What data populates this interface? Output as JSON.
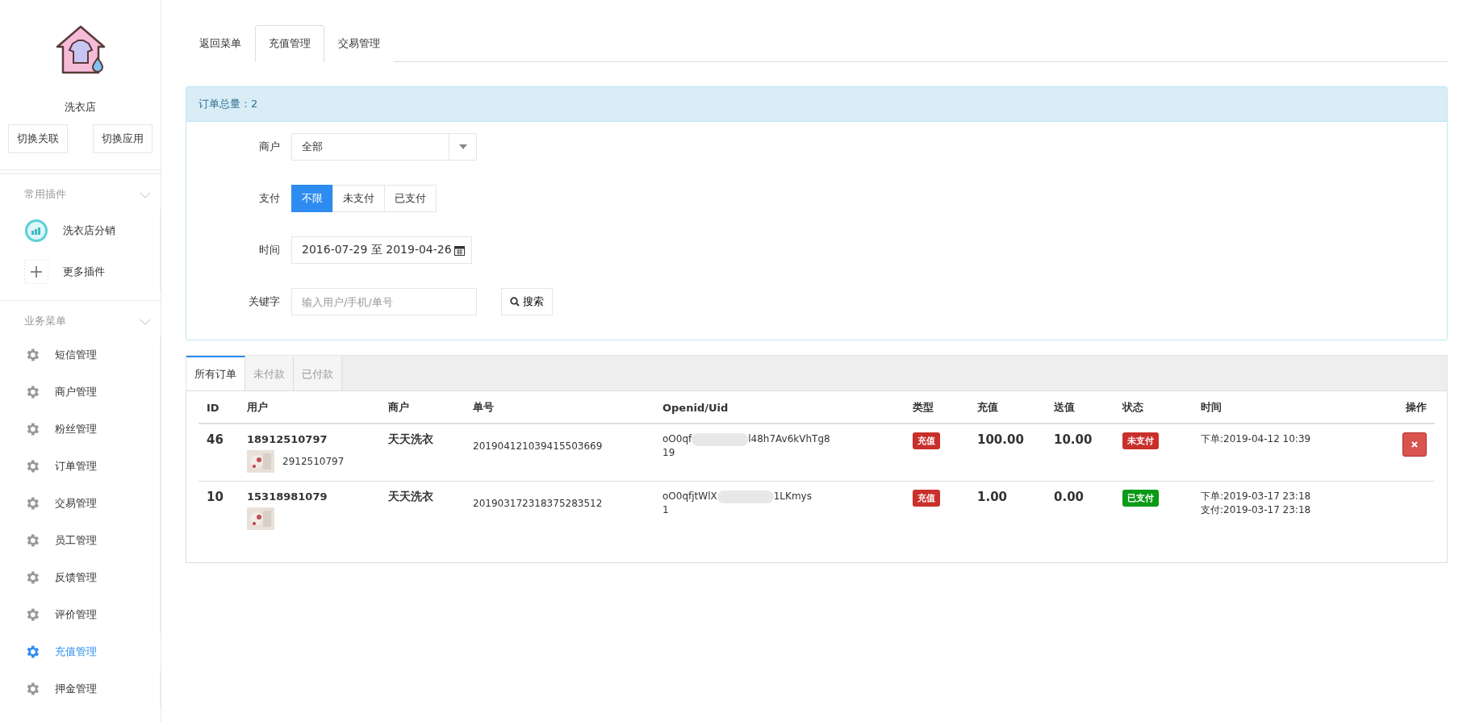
{
  "sidebar": {
    "store_name": "洗衣店",
    "buttons": [
      "切换关联",
      "切换应用"
    ],
    "sections": [
      {
        "title": "常用插件",
        "expanded": true,
        "items": [
          {
            "kind": "plugin",
            "label": "洗衣店分销",
            "selected": false
          },
          {
            "kind": "add",
            "label": "更多插件",
            "selected": false
          }
        ]
      },
      {
        "title": "业务菜单",
        "expanded": true,
        "items": [
          {
            "kind": "menu",
            "label": "短信管理",
            "selected": false
          },
          {
            "kind": "menu",
            "label": "商户管理",
            "selected": false
          },
          {
            "kind": "menu",
            "label": "粉丝管理",
            "selected": false
          },
          {
            "kind": "menu",
            "label": "订单管理",
            "selected": false
          },
          {
            "kind": "menu",
            "label": "交易管理",
            "selected": false
          },
          {
            "kind": "menu",
            "label": "员工管理",
            "selected": false
          },
          {
            "kind": "menu",
            "label": "反馈管理",
            "selected": false
          },
          {
            "kind": "menu",
            "label": "评价管理",
            "selected": false
          },
          {
            "kind": "menu",
            "label": "充值管理",
            "selected": true
          },
          {
            "kind": "menu",
            "label": "押金管理",
            "selected": false
          }
        ]
      }
    ]
  },
  "tabs": [
    {
      "label": "返回菜单",
      "selected": false
    },
    {
      "label": "充值管理",
      "selected": true
    },
    {
      "label": "交易管理",
      "selected": false
    }
  ],
  "summary": "订单总量：2",
  "filters": {
    "merchant": {
      "label": "商户",
      "value": "全部"
    },
    "payment": {
      "label": "支付",
      "options": [
        {
          "label": "不限",
          "selected": true
        },
        {
          "label": "未支付",
          "selected": false
        },
        {
          "label": "已支付",
          "selected": false
        }
      ]
    },
    "time": {
      "label": "时间",
      "value": "2016-07-29 至 2019-04-26"
    },
    "keyword": {
      "label": "关键字",
      "placeholder": "输入用户/手机/单号"
    },
    "search_button": "搜索"
  },
  "order_tabs": [
    {
      "label": "所有订单",
      "selected": true
    },
    {
      "label": "未付款",
      "selected": false
    },
    {
      "label": "已付款",
      "selected": false
    }
  ],
  "table": {
    "columns": [
      "ID",
      "用户",
      "商户",
      "单号",
      "Openid/Uid",
      "类型",
      "充值",
      "送值",
      "状态",
      "时间",
      "操作"
    ],
    "rows": [
      {
        "id": "46",
        "user_name": "18912510797",
        "user_sub": "2912510797",
        "merchant": "天天洗衣",
        "order_no": "201904121039415503669",
        "openid_start": "oO0qf",
        "openid_end": "l48h7Av6kVhTg8",
        "openid_tail": "19",
        "type": "充值",
        "amount": "100.00",
        "bonus": "10.00",
        "status": {
          "label": "未支付",
          "paid": false
        },
        "times": [
          "下单:2019-04-12 10:39"
        ],
        "deletable": true
      },
      {
        "id": "10",
        "user_name": "15318981079",
        "user_sub": "",
        "merchant": "天天洗衣",
        "order_no": "201903172318375283512",
        "openid_start": "oO0qfjtWlX",
        "openid_end": "1LKmys",
        "openid_tail": "1",
        "type": "充值",
        "amount": "1.00",
        "bonus": "0.00",
        "status": {
          "label": "已支付",
          "paid": true
        },
        "times": [
          "下单:2019-03-17 23:18",
          "支付:2019-03-17 23:18"
        ],
        "deletable": false
      }
    ]
  }
}
